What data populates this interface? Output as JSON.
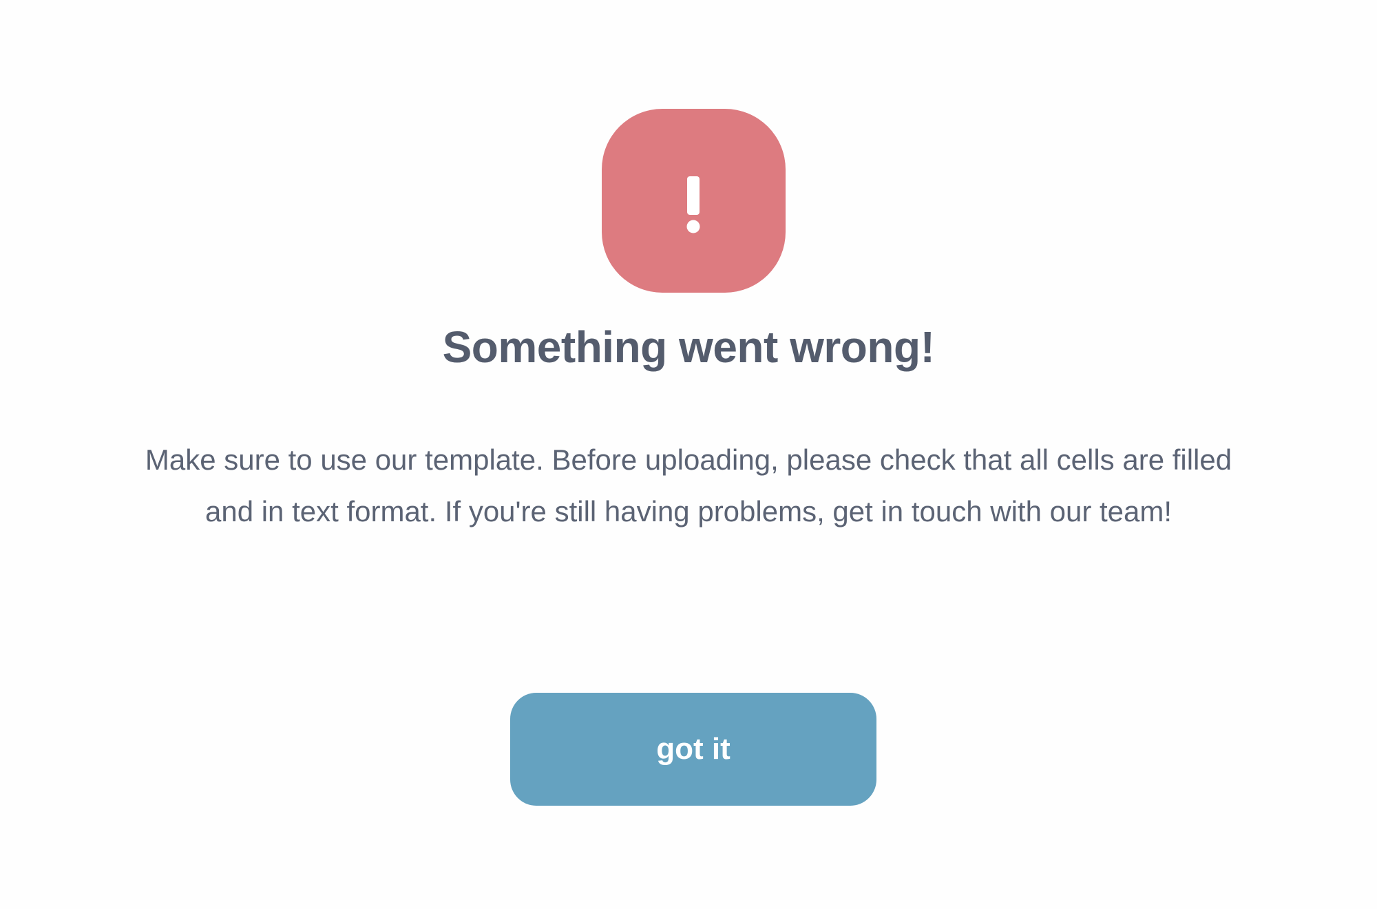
{
  "dialog": {
    "icon": "exclamation-icon",
    "icon_color": "#dd7b80",
    "title": "Something went wrong!",
    "message": "Make sure to use our template. Before uploading, please check that all cells are filled and in text format. If you're still having problems, get in touch with our team!",
    "button_label": "got it",
    "button_color": "#65a2c0"
  }
}
